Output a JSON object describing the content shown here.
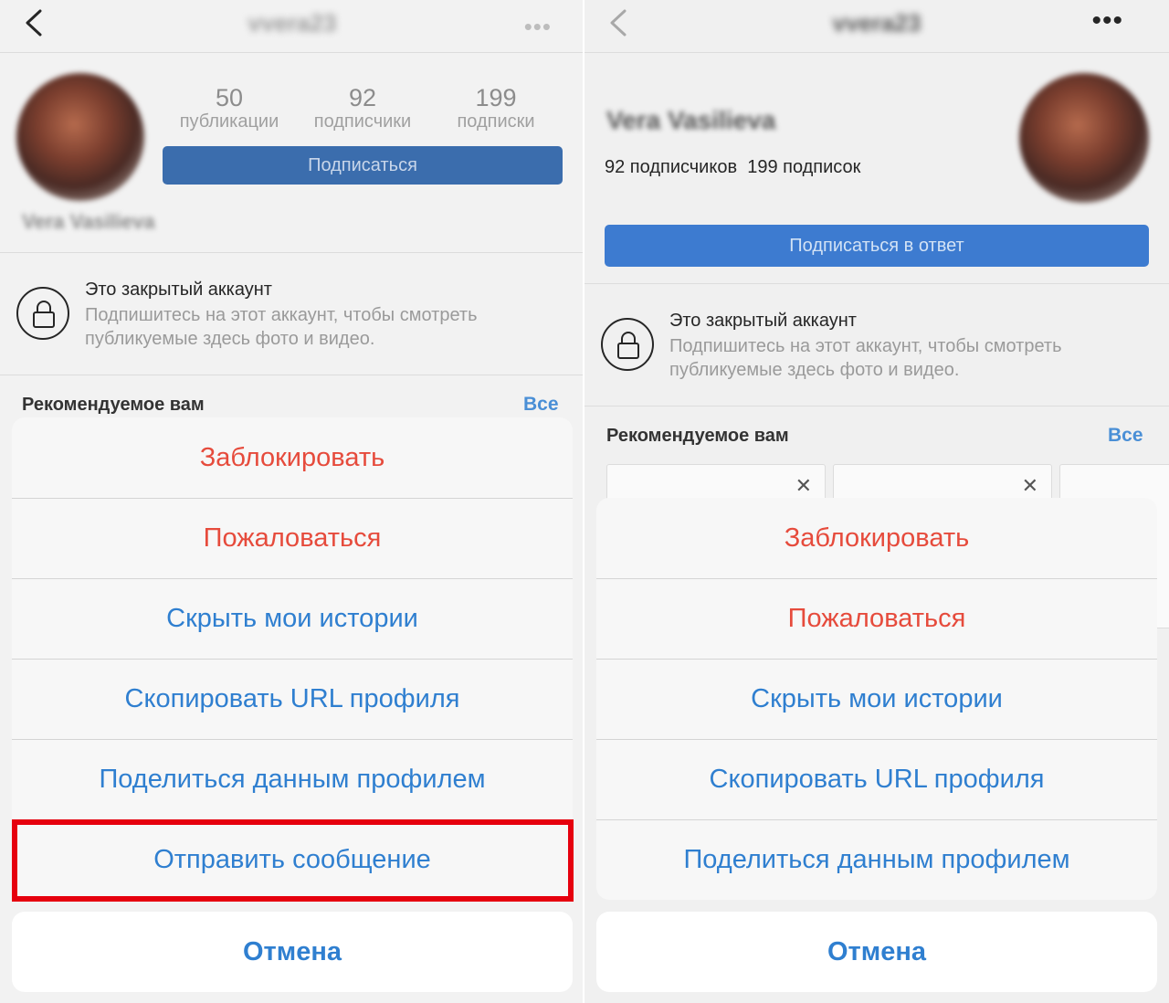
{
  "left": {
    "username": "vvera23",
    "stats": [
      {
        "num": "50",
        "label": "публикации"
      },
      {
        "num": "92",
        "label": "подписчики"
      },
      {
        "num": "199",
        "label": "подписки"
      }
    ],
    "follow_button": "Подписаться",
    "display_name": "Vera Vasilieva",
    "private_title": "Это закрытый аккаунт",
    "private_text": "Подпишитесь на этот аккаунт, чтобы смотреть публикуемые здесь фото и видео.",
    "recommended_title": "Рекомендуемое вам",
    "recommended_all": "Все",
    "sheet": [
      {
        "label": "Заблокировать",
        "kind": "danger"
      },
      {
        "label": "Пожаловаться",
        "kind": "danger"
      },
      {
        "label": "Скрыть мои истории",
        "kind": "default"
      },
      {
        "label": "Скопировать URL профиля",
        "kind": "default"
      },
      {
        "label": "Поделиться данным профилем",
        "kind": "default"
      },
      {
        "label": "Отправить сообщение",
        "kind": "default"
      }
    ],
    "cancel": "Отмена"
  },
  "right": {
    "username": "vvera23",
    "display_name": "Vera Vasilieva",
    "counts_text": "92 подписчиков  199 подписок",
    "follow_back_button": "Подписаться в ответ",
    "private_title": "Это закрытый аккаунт",
    "private_text": "Подпишитесь на этот аккаунт, чтобы смотреть публикуемые здесь фото и видео.",
    "recommended_title": "Рекомендуемое вам",
    "recommended_all": "Все",
    "sheet": [
      {
        "label": "Заблокировать",
        "kind": "danger"
      },
      {
        "label": "Пожаловаться",
        "kind": "danger"
      },
      {
        "label": "Скрыть мои истории",
        "kind": "default"
      },
      {
        "label": "Скопировать URL профиля",
        "kind": "default"
      },
      {
        "label": "Поделиться данным профилем",
        "kind": "default"
      }
    ],
    "cancel": "Отмена"
  },
  "colors": {
    "danger": "#e64b3c",
    "action": "#2f7fd0",
    "highlight": "#e6000e",
    "follow_button_bg": "#3b6dad"
  },
  "icons": [
    "back-chevron-icon",
    "more-dots-icon",
    "lock-icon",
    "close-icon"
  ]
}
